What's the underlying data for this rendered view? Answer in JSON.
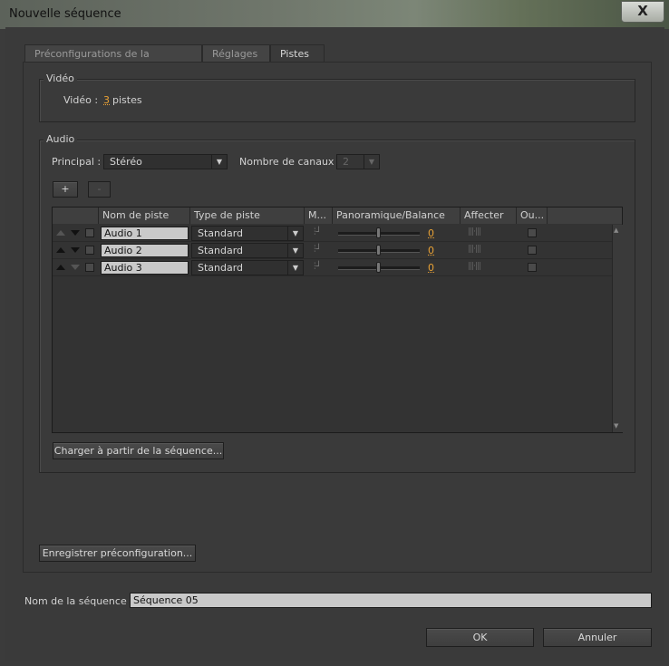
{
  "window": {
    "title": "Nouvelle séquence",
    "close_glyph": "X"
  },
  "tabs": [
    {
      "label": "Préconfigurations de la séquence",
      "active": false
    },
    {
      "label": "Réglages",
      "active": false
    },
    {
      "label": "Pistes",
      "active": true
    }
  ],
  "video": {
    "group_title": "Vidéo",
    "label": "Vidéo :",
    "count": "3",
    "unit": "pistes"
  },
  "audio": {
    "group_title": "Audio",
    "master_label": "Principal :",
    "master_value": "Stéréo",
    "channels_label": "Nombre de canaux :",
    "channels_value": "2",
    "add_label": "+",
    "remove_label": "-",
    "columns": [
      "Nom de piste",
      "Type de piste",
      "M...",
      "Panoramique/Balance",
      "Affecter",
      "Ou..."
    ],
    "tracks": [
      {
        "name": "Audio 1",
        "type": "Standard",
        "pan": "0"
      },
      {
        "name": "Audio 2",
        "type": "Standard",
        "pan": "0"
      },
      {
        "name": "Audio 3",
        "type": "Standard",
        "pan": "0"
      }
    ],
    "load_button": "Charger à partir de la séquence..."
  },
  "save_preset_button": "Enregistrer préconfiguration...",
  "sequence_name_label": "Nom de la séquence :",
  "sequence_name_value": "Séquence 05",
  "ok_button": "OK",
  "cancel_button": "Annuler",
  "colors": {
    "accent": "#e8a135",
    "background": "#3a3a3a",
    "field": "#c9c9c9"
  },
  "icons": [
    "close-icon",
    "chevron-down-icon",
    "move-up-icon",
    "move-down-icon",
    "mono-split-icon",
    "meter-icon",
    "scroll-up-icon",
    "scroll-down-icon"
  ]
}
